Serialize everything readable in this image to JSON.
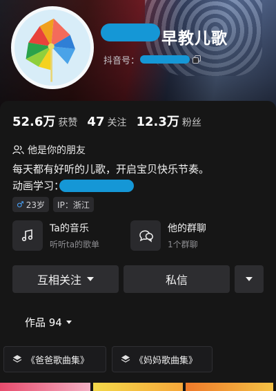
{
  "profile": {
    "nickname": "早教儿歌",
    "id_label": "抖音号：",
    "copy_icon": "copy-icon"
  },
  "stats": [
    {
      "value": "52.6万",
      "label": "获赞"
    },
    {
      "value": "47",
      "label": "关注"
    },
    {
      "value": "12.3万",
      "label": "粉丝"
    }
  ],
  "friend": "他是你的朋友",
  "bio": {
    "line1": "每天都有好听的儿歌，开启宝贝快乐节奏。",
    "line2": "动画学习："
  },
  "tags": {
    "gender_symbol": "♂",
    "age": "23岁",
    "ip": "IP：浙江"
  },
  "cards": {
    "music": {
      "title": "Ta的音乐",
      "subtitle": "听听ta的歌单"
    },
    "group": {
      "title": "他的群聊",
      "subtitle": "1个群聊"
    }
  },
  "buttons": {
    "follow": "互相关注",
    "message": "私信"
  },
  "works": {
    "label": "作品 94"
  },
  "collections": [
    "《爸爸歌曲集》",
    "《妈妈歌曲集》"
  ],
  "colors": {
    "background": "#161616",
    "button": "#2d2d30",
    "redaction": "#1597d6",
    "gender_male": "#4aa6ff"
  }
}
